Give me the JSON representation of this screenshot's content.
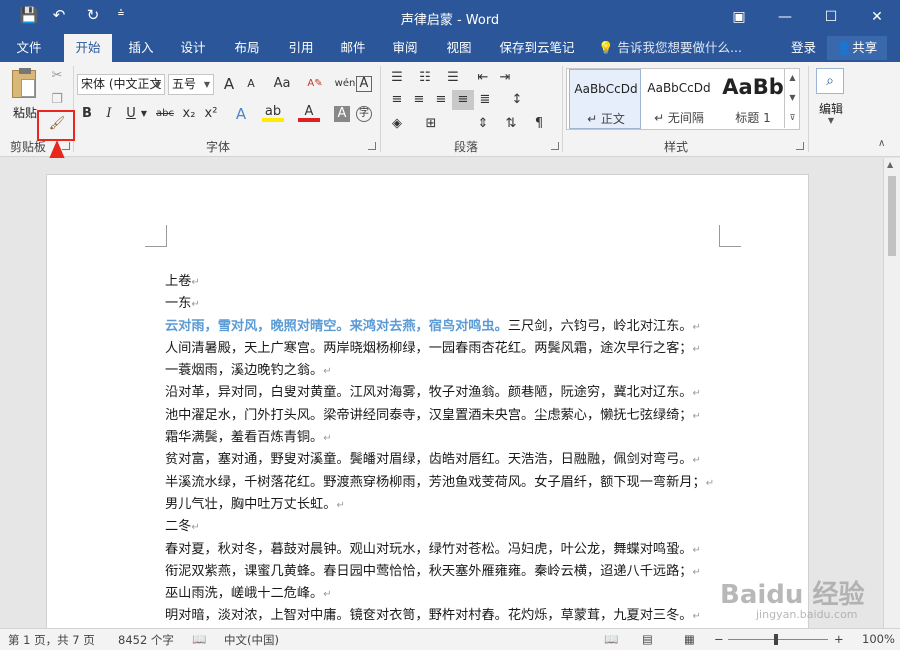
{
  "titlebar": {
    "title": "声律启蒙 - Word",
    "save_icon": "💾",
    "undo_icon": "↶",
    "redo_icon": "↻",
    "customize_icon": "⩮",
    "ribbon_display_icon": "▣",
    "minimize_icon": "—",
    "maximize_icon": "☐",
    "close_icon": "✕"
  },
  "tabs": [
    {
      "label": "文件"
    },
    {
      "label": "开始"
    },
    {
      "label": "插入"
    },
    {
      "label": "设计"
    },
    {
      "label": "布局"
    },
    {
      "label": "引用"
    },
    {
      "label": "邮件"
    },
    {
      "label": "审阅"
    },
    {
      "label": "视图"
    },
    {
      "label": "保存到云笔记"
    }
  ],
  "tell_me": "💡 告诉我您想要做什么...",
  "login": "登录",
  "share": "共享",
  "ribbon": {
    "clipboard": {
      "label": "剪贴板",
      "paste_label": "粘贴"
    },
    "font": {
      "label": "字体",
      "font_name": "宋体 (中文正文",
      "font_size": "五号",
      "grow": "A",
      "shrink": "A",
      "change_case": "Aa",
      "pinyin": "wén",
      "border_char": "A",
      "bold": "B",
      "italic": "I",
      "underline": "U",
      "strike": "abc",
      "subscript": "x₂",
      "superscript": "x²",
      "text_effect": "A",
      "highlight": "ab",
      "font_color": "A",
      "char_shading": "A",
      "enclose": "字"
    },
    "paragraph": {
      "label": "段落"
    },
    "styles": {
      "label": "样式",
      "items": [
        {
          "sample": "AaBbCcDd",
          "name": "↵ 正文"
        },
        {
          "sample": "AaBbCcDd",
          "name": "↵ 无间隔"
        },
        {
          "sample": "AaBb",
          "name": "标题 1"
        }
      ]
    },
    "editing": {
      "label": "编辑"
    }
  },
  "document": {
    "lines": [
      {
        "text": "上卷"
      },
      {
        "text": "一东"
      },
      {
        "highlight": "云对雨，雪对风，晚照对晴空。来鸿对去燕，宿鸟对鸣虫。",
        "text": "三尺剑，六钧弓，岭北对江东。"
      },
      {
        "text": "人间清暑殿，天上广寒宫。两岸晓烟杨柳绿，一园春雨杏花红。两鬓风霜，途次早行之客；"
      },
      {
        "text": "一蓑烟雨，溪边晚钓之翁。"
      },
      {
        "text": "沿对革，异对同，白叟对黄童。江风对海雾，牧子对渔翁。颜巷陋，阮途穷，冀北对辽东。"
      },
      {
        "text": "池中濯足水，门外打头风。梁帝讲经同泰寺，汉皇置酒未央宫。尘虑萦心，懒抚七弦绿绮；"
      },
      {
        "text": "霜华满鬓，羞看百炼青铜。"
      },
      {
        "text": "贫对富，塞对通，野叟对溪童。鬓皤对眉绿，齿皓对唇红。天浩浩，日融融，佩剑对弯弓。"
      },
      {
        "text": "半溪流水绿，千树落花红。野渡燕穿杨柳雨，芳池鱼戏芰荷风。女子眉纤，额下现一弯新月；"
      },
      {
        "text": "男儿气壮，胸中吐万丈长虹。"
      },
      {
        "text": "二冬"
      },
      {
        "text": "春对夏，秋对冬，暮鼓对晨钟。观山对玩水，绿竹对苍松。冯妇虎，叶公龙，舞蝶对鸣蛩。"
      },
      {
        "text": "衔泥双紫燕，课蜜几黄蜂。春日园中莺恰恰，秋天塞外雁雍雍。秦岭云横，迢递八千远路；"
      },
      {
        "text": "巫山雨洗，嵯峨十二危峰。"
      },
      {
        "text": "明对暗，淡对浓，上智对中庸。镜奁对衣笥，野杵对村舂。花灼烁，草蒙茸，九夏对三冬。"
      },
      {
        "text": "台高名戏马，斋小号蟠龙。手擘蟹螯从毕卓，身披鹤氅自王恭。五老峰高，秀插云霄如玉笔；"
      }
    ]
  },
  "status": {
    "page": "第 1 页，共 7 页",
    "words": "8452 个字",
    "language": "中文(中国)",
    "zoom": "100%"
  },
  "watermark": "Baidu 经验",
  "watermark_sub": "jingyan.baidu.com"
}
